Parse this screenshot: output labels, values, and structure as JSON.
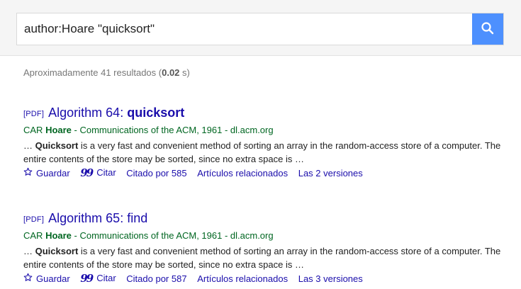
{
  "search": {
    "query": "author:Hoare \"quicksort\"",
    "button_icon": "search-icon"
  },
  "results_count": {
    "prefix": "Aproximadamente 41 resultados (",
    "time": "0.02",
    "suffix": " s)"
  },
  "results": [
    {
      "tag": "[PDF]",
      "title_prefix": "Algorithm 64: ",
      "title_bold": "quicksort",
      "meta_prefix": "CAR ",
      "meta_author": "Hoare",
      "meta_suffix": " - Communications of the ACM, 1961 - dl.acm.org",
      "snippet_prefix": "… ",
      "snippet_bold": "Quicksort",
      "snippet_rest": " is a very fast and convenient method of sorting an array in the random-access store of a computer. The entire contents of the store may be sorted, since no extra space is …",
      "links": {
        "save": "Guardar",
        "cite": "Citar",
        "cited_by": "Citado por 585",
        "related": "Artículos relacionados",
        "versions": "Las 2 versiones"
      }
    },
    {
      "tag": "[PDF]",
      "title_prefix": "Algorithm 65: find",
      "title_bold": "",
      "meta_prefix": "CAR ",
      "meta_author": "Hoare",
      "meta_suffix": " - Communications of the ACM, 1961 - dl.acm.org",
      "snippet_prefix": "… ",
      "snippet_bold": "Quicksort",
      "snippet_rest": " is a very fast and convenient method of sorting an array in the random-access store of a computer. The entire contents of the store may be sorted, since no extra space is …",
      "links": {
        "save": "Guardar",
        "cite": "Citar",
        "cited_by": "Citado por 587",
        "related": "Artículos relacionados",
        "versions": "Las 3 versiones"
      }
    }
  ],
  "colors": {
    "link": "#1a0dab",
    "meta_green": "#006621",
    "search_button": "#4d90fe"
  }
}
